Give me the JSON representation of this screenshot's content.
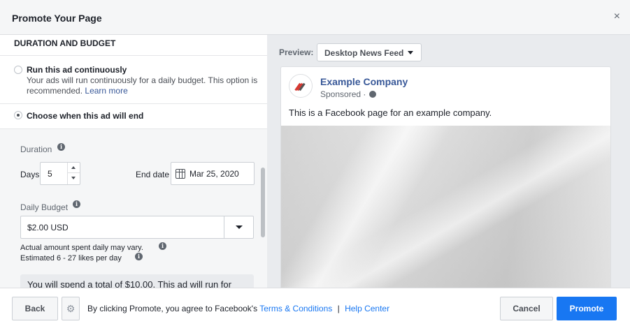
{
  "header": {
    "title": "Promote Your Page",
    "close_glyph": "×"
  },
  "left": {
    "section_title": "DURATION AND BUDGET",
    "option_continuous": {
      "label": "Run this ad continuously",
      "desc_line1": "Your ads will run continuously for a daily budget. This option is",
      "desc_line2": "recommended.",
      "learn_more": "Learn more",
      "selected": false
    },
    "option_end": {
      "label": "Choose when this ad will end",
      "selected": true
    },
    "duration": {
      "label": "Duration",
      "days_label": "Days",
      "days_value": "5",
      "end_date_label": "End date",
      "end_date": "Mar 25, 2020"
    },
    "budget": {
      "label": "Daily Budget",
      "value": "$2.00 USD",
      "note1": "Actual amount spent daily may vary.",
      "note2": "Estimated 6 - 27 likes per day",
      "total_text": "You will spend a total of $10.00. This ad will run for"
    }
  },
  "preview": {
    "label": "Preview:",
    "placement": "Desktop News Feed",
    "page_name": "Example Company",
    "sponsored": "Sponsored ·",
    "post_text": "This is a Facebook page for an example company."
  },
  "footer": {
    "back": "Back",
    "gear_glyph": "⚙",
    "agree_text": "By clicking Promote, you agree to Facebook's",
    "terms_link": "Terms & Conditions",
    "pipe": "|",
    "help_link": "Help Center",
    "cancel": "Cancel",
    "promote": "Promote"
  },
  "colors": {
    "accent": "#1877f2",
    "link": "#385898",
    "logo_red": "#d63a33"
  }
}
